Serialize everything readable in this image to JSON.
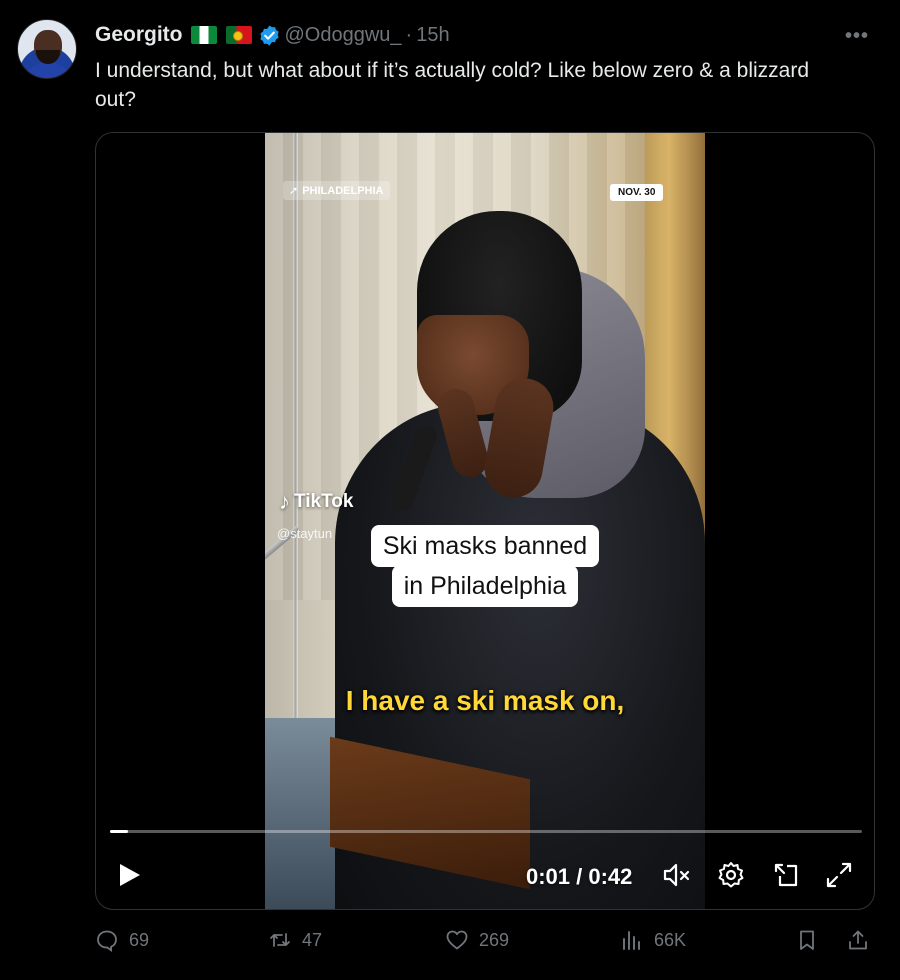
{
  "tweet": {
    "display_name": "Georgito",
    "handle": "@Odoggwu_",
    "separator": "·",
    "time": "15h",
    "more_label": "•••",
    "text": "I understand, but what about if it’s actually cold? Like below zero & a blizzard out?"
  },
  "video": {
    "location_tag": "PHILADELPHIA",
    "date_tag": "NOV. 30",
    "watermark": "TikTok",
    "watermark_handle": "@staytun",
    "caption_line1": "Ski masks banned",
    "caption_line2": "in Philadelphia",
    "subtitle": "I have a ski mask on,",
    "time_readout": "0:01 / 0:42",
    "progress": 0.024,
    "icons": [
      "play-icon",
      "mute-icon",
      "settings-icon",
      "picture-in-picture-icon",
      "fullscreen-icon"
    ]
  },
  "actions": {
    "replies": "69",
    "reposts": "47",
    "likes": "269",
    "views": "66K"
  },
  "colors": {
    "background": "#000000",
    "text": "#e7e9ea",
    "muted": "#71767b",
    "verified": "#1d9bf0",
    "subtitle": "#ffd736"
  }
}
